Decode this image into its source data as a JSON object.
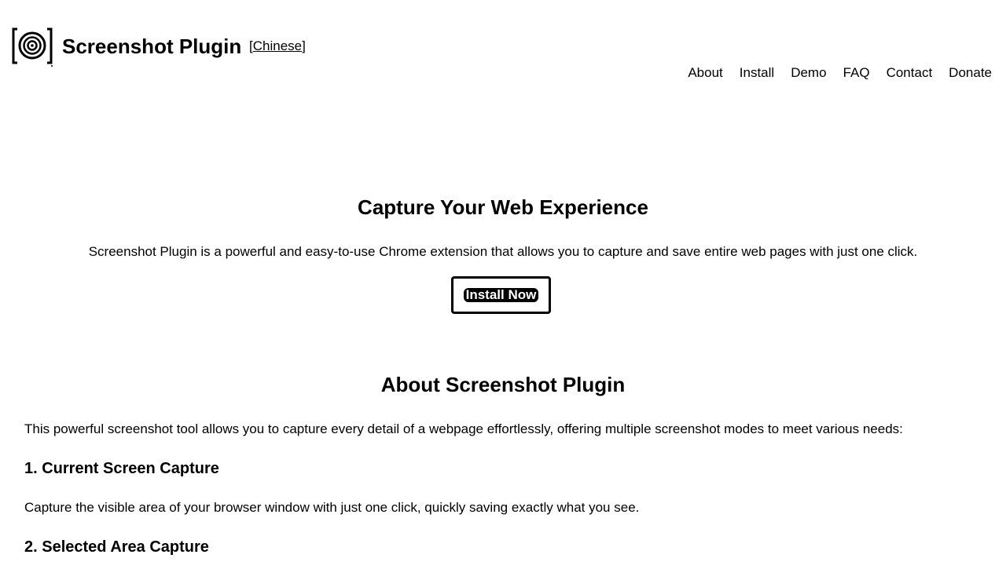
{
  "header": {
    "logo_icon": "camera-lens-icon",
    "title": "Screenshot Plugin",
    "lang_open": "[",
    "lang_label": "Chinese",
    "lang_close": "]"
  },
  "nav": {
    "items": [
      {
        "label": "About"
      },
      {
        "label": "Install"
      },
      {
        "label": "Demo"
      },
      {
        "label": "FAQ"
      },
      {
        "label": "Contact"
      },
      {
        "label": "Donate"
      }
    ]
  },
  "hero": {
    "title": "Capture Your Web Experience",
    "description": "Screenshot Plugin is a powerful and easy-to-use Chrome extension that allows you to capture and save entire web pages with just one click.",
    "install_button": "Install Now"
  },
  "about": {
    "title": "About Screenshot Plugin",
    "intro": "This powerful screenshot tool allows you to capture every detail of a webpage effortlessly, offering multiple screenshot modes to meet various needs:",
    "features": [
      {
        "heading": "1. Current Screen Capture",
        "text": "Capture the visible area of your browser window with just one click, quickly saving exactly what you see."
      },
      {
        "heading": "2. Selected Area Capture"
      }
    ]
  }
}
